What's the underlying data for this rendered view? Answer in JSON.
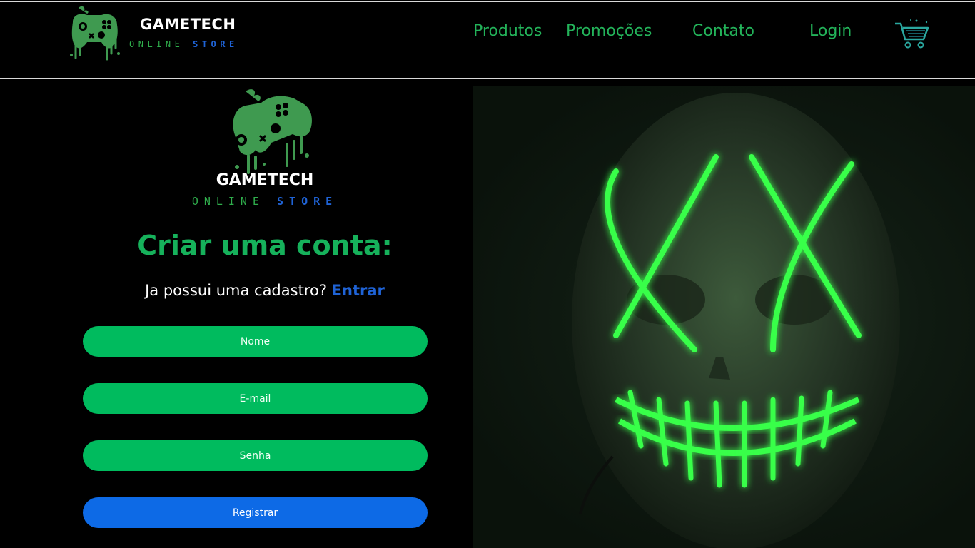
{
  "header": {
    "brand_title": "GAMETECH",
    "brand_sub_online": "ONLINE",
    "brand_sub_store": "STORE"
  },
  "nav": {
    "items": [
      {
        "label": "Produtos"
      },
      {
        "label": "Promoções"
      },
      {
        "label": "Contato"
      },
      {
        "label": "Login"
      }
    ],
    "cart_icon": "shopping-cart-icon"
  },
  "hero": {
    "title": "GAMETECH",
    "sub_online": "ONLINE",
    "sub_store": "STORE",
    "logo_icon": "gamepad-splash-icon"
  },
  "form": {
    "title": "Criar uma conta:",
    "have_account_text": "Ja possui uma cadastro?",
    "login_link": "Entrar",
    "name_placeholder": "Nome",
    "email_placeholder": "E-mail",
    "password_placeholder": "Senha",
    "register_label": "Registrar"
  },
  "colors": {
    "accent_green": "#00bb5e",
    "accent_blue": "#0d6ae6",
    "nav_green": "#23b35a",
    "background": "#000000"
  }
}
